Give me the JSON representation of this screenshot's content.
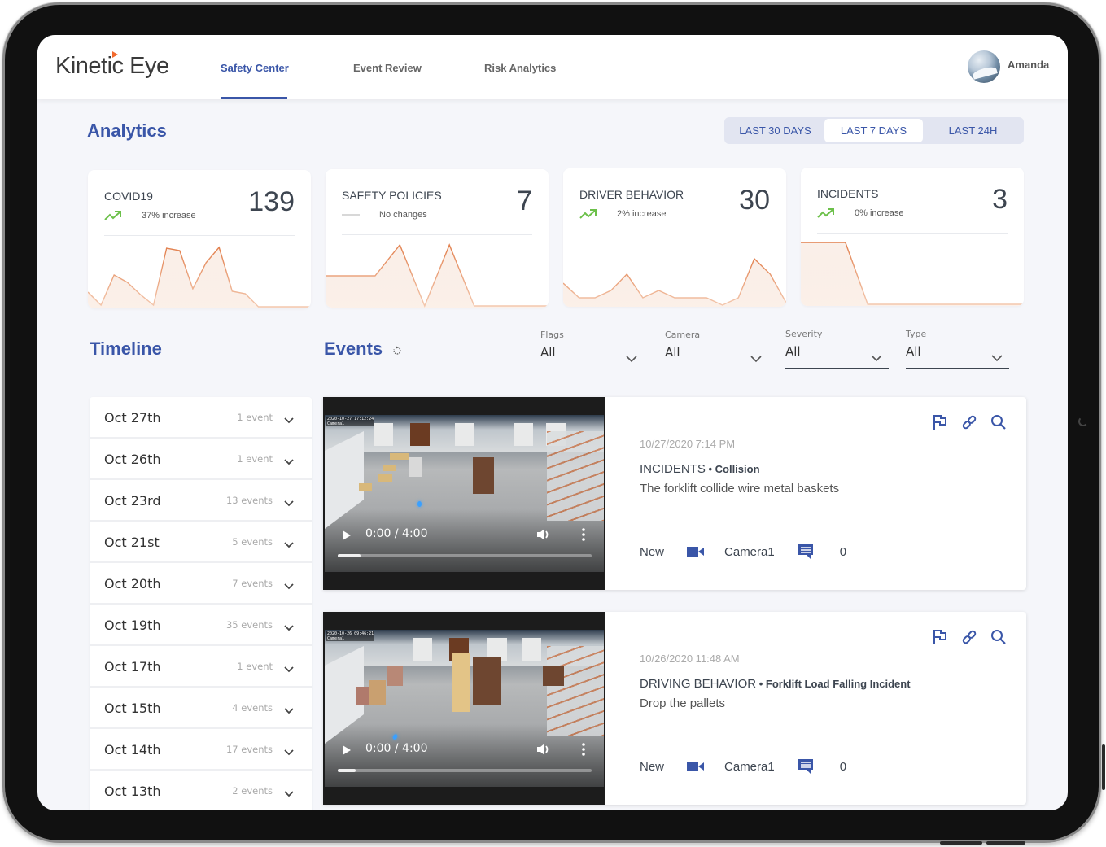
{
  "app": {
    "logo_text": "Kinetic Eye",
    "accent_color": "#3a56a8",
    "brand_orange": "#f26a2e"
  },
  "nav": {
    "tabs": [
      {
        "label": "Safety Center",
        "active": true
      },
      {
        "label": "Event Review",
        "active": false
      },
      {
        "label": "Risk Analytics",
        "active": false
      }
    ],
    "user_name": "Amanda"
  },
  "analytics": {
    "title": "Analytics",
    "ranges": [
      {
        "label": "LAST 30 DAYS",
        "active": false
      },
      {
        "label": "LAST 7 DAYS",
        "active": true
      },
      {
        "label": "LAST 24H",
        "active": false
      }
    ],
    "cards": [
      {
        "title": "COVID19",
        "value": "139",
        "trend": "up",
        "trend_text": "37%  increase",
        "spark": [
          18,
          2,
          39,
          30,
          15,
          2,
          72,
          69,
          22,
          54,
          73,
          19,
          16,
          0,
          0,
          0,
          0,
          0
        ]
      },
      {
        "title": "SAFETY POLICIES",
        "value": "7",
        "trend": "flat",
        "trend_text": "No changes",
        "spark": [
          37,
          37,
          37,
          75,
          0,
          75,
          0,
          0,
          0,
          0
        ]
      },
      {
        "title": "DRIVER BEHAVIOR",
        "value": "30",
        "trend": "up",
        "trend_text": "2%  increase",
        "spark": [
          27,
          9,
          9,
          18,
          38,
          9,
          18,
          9,
          9,
          9,
          0,
          9,
          57,
          38,
          3
        ]
      },
      {
        "title": "INCIDENTS",
        "value": "3",
        "trend": "up",
        "trend_text": "0%  increase",
        "spark": [
          76,
          76,
          76,
          0,
          0,
          0,
          0,
          0,
          0,
          0,
          0
        ]
      }
    ]
  },
  "timeline": {
    "title": "Timeline",
    "items": [
      {
        "date": "Oct 27th",
        "count": "1 event"
      },
      {
        "date": "Oct 26th",
        "count": "1 event"
      },
      {
        "date": "Oct 23rd",
        "count": "13 events"
      },
      {
        "date": "Oct 21st",
        "count": "5 events"
      },
      {
        "date": "Oct 20th",
        "count": "7 events"
      },
      {
        "date": "Oct 19th",
        "count": "35 events"
      },
      {
        "date": "Oct 17th",
        "count": "1 event"
      },
      {
        "date": "Oct 15th",
        "count": "4 events"
      },
      {
        "date": "Oct 14th",
        "count": "17 events"
      },
      {
        "date": "Oct 13th",
        "count": "2 events"
      }
    ]
  },
  "events": {
    "title": "Events",
    "filters": [
      {
        "label": "Flags",
        "value": "All"
      },
      {
        "label": "Camera",
        "value": "All"
      },
      {
        "label": "Severity",
        "value": "All"
      },
      {
        "label": "Type",
        "value": "All"
      }
    ],
    "items": [
      {
        "timestamp": "10/27/2020 7:14 PM",
        "category": "INCIDENTS",
        "subtype": "Collision",
        "description": "The forklift collide wire metal baskets",
        "status": "New",
        "camera": "Camera1",
        "comments": "0",
        "video_time": "0:00 / 4:00",
        "video_progress": 0.09,
        "video_stamp": "2020-10-27 17:12:24",
        "video_camera_label": "Camera1"
      },
      {
        "timestamp": "10/26/2020 11:48 AM",
        "category": "DRIVING BEHAVIOR",
        "subtype": "Forklift Load Falling Incident",
        "description": "Drop the pallets",
        "status": "New",
        "camera": "Camera1",
        "comments": "0",
        "video_time": "0:00 / 4:00",
        "video_progress": 0.07,
        "video_stamp": "2020-10-26 09:46:21",
        "video_camera_label": "Camera1"
      }
    ]
  }
}
